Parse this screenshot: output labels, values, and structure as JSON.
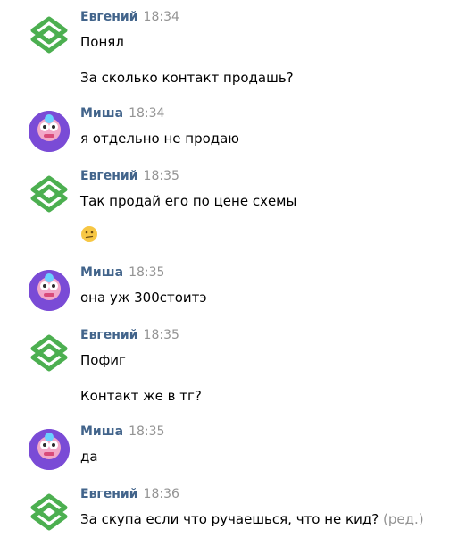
{
  "users": {
    "evgeniy": "Евгений",
    "misha": "Миша"
  },
  "messages": [
    {
      "author": "Евгений",
      "time": "18:34",
      "lines": [
        "Понял",
        "За сколько контакт продашь?"
      ]
    },
    {
      "author": "Миша",
      "time": "18:34",
      "lines": [
        "я отдельно не продаю"
      ]
    },
    {
      "author": "Евгений",
      "time": "18:35",
      "lines": [
        "Так продай его по цене схемы"
      ],
      "emoji": "neutral-face-emoji"
    },
    {
      "author": "Миша",
      "time": "18:35",
      "lines": [
        "она уж 300стоитэ"
      ]
    },
    {
      "author": "Евгений",
      "time": "18:35",
      "lines": [
        "Пофиг",
        "Контакт же в тг?"
      ]
    },
    {
      "author": "Миша",
      "time": "18:35",
      "lines": [
        "да"
      ]
    },
    {
      "author": "Евгений",
      "time": "18:36",
      "lines": [
        "За скупа если что ручаешься, что не кид?"
      ],
      "edited": "(ред.)"
    }
  ],
  "colors": {
    "author": "#42648b",
    "time": "#939393",
    "text": "#000000",
    "logo_green": "#4caf50",
    "avatar_purple": "#7a4bd6"
  }
}
